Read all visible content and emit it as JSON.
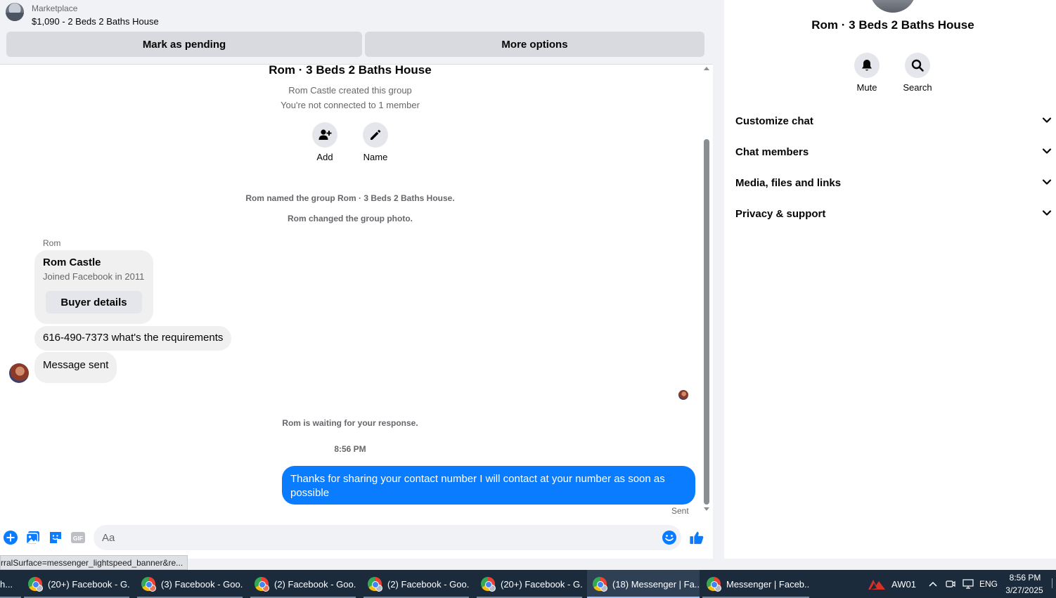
{
  "topbar": {
    "source": "Marketplace",
    "listing": "$1,090 - 2 Beds 2 Baths House",
    "mark_pending": "Mark as pending",
    "more_options": "More options"
  },
  "thread": {
    "group_title": "Rom · 3 Beds 2 Baths House",
    "created_by": "Rom Castle created this group",
    "not_connected": "You're not connected to 1 member",
    "add_label": "Add",
    "name_label": "Name",
    "event_named": "Rom named the group Rom · 3 Beds 2 Baths House.",
    "event_photo": "Rom changed the group photo.",
    "sender": "Rom",
    "profile_card": {
      "name": "Rom Castle",
      "joined": "Joined Facebook in 2011",
      "button": "Buyer details"
    },
    "incoming": [
      "616-490-7373 what's the requirements",
      "Message sent"
    ],
    "waiting": "Rom is waiting for your response.",
    "timestamp": "8:56 PM",
    "outgoing": "Thanks for sharing your contact number I will contact at your number as soon as possible",
    "outgoing_status": "Sent"
  },
  "composer": {
    "placeholder": "Aa",
    "icons": [
      "plus-icon",
      "photo-icon",
      "sticker-icon",
      "gif-icon",
      "emoji-icon",
      "like-icon"
    ],
    "gif_label": "GIF"
  },
  "status_url": "rralSurface=messenger_lightspeed_banner&re...",
  "info_panel": {
    "title": "Rom · 3 Beds 2 Baths House",
    "mute_label": "Mute",
    "search_label": "Search",
    "sections": [
      "Customize chat",
      "Chat members",
      "Media, files and links",
      "Privacy & support"
    ]
  },
  "taskbar": {
    "tasks": [
      "h...",
      "(20+) Facebook - G...",
      "(3) Facebook - Goo...",
      "(2) Facebook - Goo...",
      "(2) Facebook - Goo...",
      "(20+) Facebook - G...",
      "(18) Messenger | Fa...",
      "Messenger | Faceb..."
    ],
    "tray_app": "AW01",
    "language": "ENG",
    "time": "8:56 PM",
    "date": "3/27/2025"
  },
  "colors": {
    "accent": "#0a7cff",
    "taskbar": "#1c2b3c",
    "bubble_in": "#f0f0f0"
  }
}
